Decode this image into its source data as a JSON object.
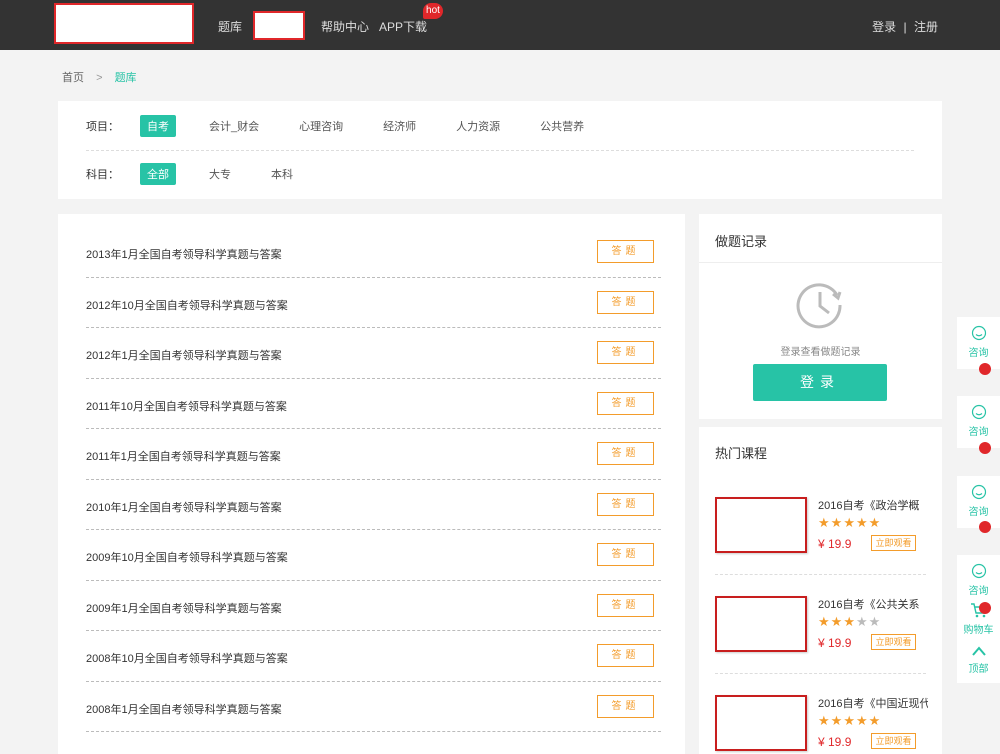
{
  "header": {
    "nav": [
      "题库",
      "帮助中心",
      "APP下载"
    ],
    "hot_badge": "hot",
    "login": "登录",
    "divider": "|",
    "register": "注册"
  },
  "breadcrumb": {
    "home": "首页",
    "separator": ">",
    "current": "题库"
  },
  "filters": {
    "project_label": "项目：",
    "projects": [
      "自考",
      "会计_财会",
      "心理咨询",
      "经济师",
      "人力资源",
      "公共营养"
    ],
    "subject_label": "科目：",
    "subjects": [
      "全部",
      "大专",
      "本科"
    ]
  },
  "exams": [
    "2013年1月全国自考领导科学真题与答案",
    "2012年10月全国自考领导科学真题与答案",
    "2012年1月全国自考领导科学真题与答案",
    "2011年10月全国自考领导科学真题与答案",
    "2011年1月全国自考领导科学真题与答案",
    "2010年1月全国自考领导科学真题与答案",
    "2009年10月全国自考领导科学真题与答案",
    "2009年1月全国自考领导科学真题与答案",
    "2008年10月全国自考领导科学真题与答案",
    "2008年1月全国自考领导科学真题与答案"
  ],
  "exam_button": "答题",
  "record": {
    "title": "做题记录",
    "hint": "登录查看做题记录",
    "login_button": "登录"
  },
  "hot_courses": {
    "title": "热门课程",
    "items": [
      {
        "name": "2016自考《政治学概",
        "rating": 5,
        "price": "¥ 19.9",
        "button": "立即观看"
      },
      {
        "name": "2016自考《公共关系",
        "rating": 3,
        "price": "¥ 19.9",
        "button": "立即观看"
      },
      {
        "name": "2016自考《中国近现代",
        "rating": 5,
        "price": "¥ 19.9",
        "button": "立即观看"
      }
    ]
  },
  "float_bar": {
    "consult": "咨询",
    "cart": "购物车",
    "top": "顶部"
  },
  "colors": {
    "accent": "#27c3a6",
    "orange": "#f39c2b",
    "red": "#e0272a",
    "topbar": "#333333"
  }
}
